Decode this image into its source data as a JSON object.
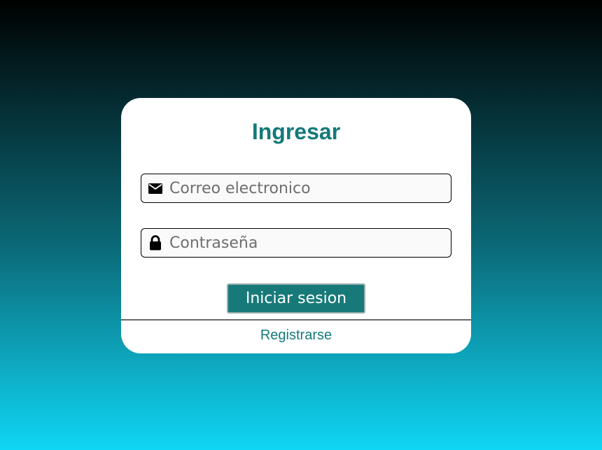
{
  "login": {
    "title": "Ingresar",
    "email_placeholder": "Correo electronico",
    "email_value": "",
    "password_placeholder": "Contraseña",
    "password_value": "",
    "submit_label": "Iniciar sesion",
    "register_link": "Registrarse"
  },
  "icons": {
    "email": "envelope-icon",
    "password": "lock-icon"
  },
  "colors": {
    "accent": "#14797a",
    "button": "#177a79",
    "gradient_top": "#000000",
    "gradient_bottom": "#0fd6f4"
  }
}
